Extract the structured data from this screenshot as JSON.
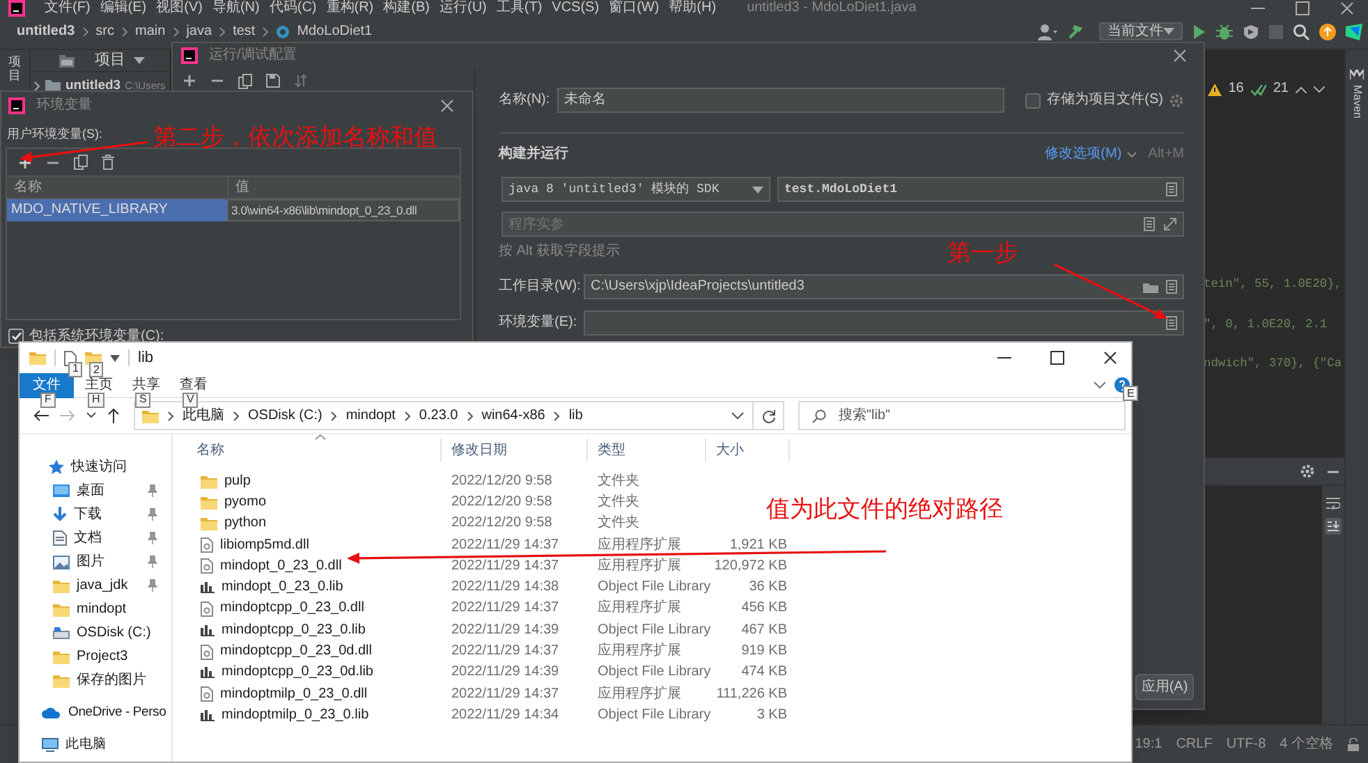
{
  "ide": {
    "title": "untitled3 - MdoLoDiet1.java",
    "menu": [
      "文件(F)",
      "编辑(E)",
      "视图(V)",
      "导航(N)",
      "代码(C)",
      "重构(R)",
      "构建(B)",
      "运行(U)",
      "工具(T)",
      "VCS(S)",
      "窗口(W)",
      "帮助(H)"
    ],
    "breadcrumbs": [
      "untitled3",
      "src",
      "main",
      "java",
      "test",
      "MdoLoDiet1"
    ],
    "run_target": "当前文件",
    "left_tab": "项目",
    "project_tab": "项目",
    "project_root": {
      "name": "untitled3",
      "path": "C:\\Users"
    },
    "inspections": {
      "warnings": "16",
      "checks": "21"
    },
    "code_lines": [
      "tein\", 55, 1.0E20},",
      "\", 0, 1.0E20, 2.1",
      "ndwich\", 370}, {\"Ca"
    ],
    "right_tab": "Maven",
    "status_bar": [
      "19:1",
      "CRLF",
      "UTF-8",
      "4 个空格"
    ]
  },
  "run_dialog": {
    "title": "运行/调试配置",
    "name_label": "名称(N):",
    "name_value": "未命名",
    "store_checkbox": {
      "label": "存储为项目文件(S)",
      "checked": false
    },
    "section": "构建并运行",
    "modify_link": "修改选项(M)",
    "shortcut": "Alt+M",
    "sdk": "java 8 'untitled3' 模块的 SDK",
    "main_class": "test.MdoLoDiet1",
    "args_placeholder": "程序实参",
    "hint": "按 Alt 获取字段提示",
    "workdir_label": "工作目录(W):",
    "workdir_value": "C:\\Users\\xjp\\IdeaProjects\\untitled3",
    "env_label": "环境变量(E):",
    "apply_button": "应用(A)"
  },
  "env_dialog": {
    "title": "环境变量",
    "user_label": "用户环境变量(S):",
    "columns": [
      "名称",
      "值"
    ],
    "rows": [
      {
        "name": "MDO_NATIVE_LIBRARY",
        "value": "3.0\\win64-x86\\lib\\mindopt_0_23_0.dll",
        "selected": true
      }
    ],
    "include_system": {
      "label": "包括系统环境变量(C):",
      "checked": true
    }
  },
  "explorer": {
    "title": "lib",
    "quick_access": [
      {
        "key_tip": "1"
      },
      {
        "key_tip": "2"
      }
    ],
    "ribbon": [
      {
        "label": "文件",
        "key_tip": "F",
        "kind": "file_menu"
      },
      {
        "label": "主页",
        "key_tip": "H",
        "kind": "tab"
      },
      {
        "label": "共享",
        "key_tip": "S",
        "kind": "tab"
      },
      {
        "label": "查看",
        "key_tip": "V",
        "kind": "tab"
      }
    ],
    "help_key_tip": "E",
    "address": [
      "此电脑",
      "OSDisk (C:)",
      "mindopt",
      "0.23.0",
      "win64-x86",
      "lib"
    ],
    "search_placeholder": "搜索\"lib\"",
    "nav": [
      {
        "label": "快速访问",
        "kind": "quick",
        "pinned": false
      },
      {
        "label": "桌面",
        "kind": "desktop",
        "pinned": true
      },
      {
        "label": "下载",
        "kind": "download",
        "pinned": true
      },
      {
        "label": "文档",
        "kind": "documents",
        "pinned": true
      },
      {
        "label": "图片",
        "kind": "pictures",
        "pinned": true
      },
      {
        "label": "java_jdk",
        "kind": "folder",
        "pinned": true
      },
      {
        "label": "mindopt",
        "kind": "folder",
        "pinned": false
      },
      {
        "label": "OSDisk (C:)",
        "kind": "drive",
        "pinned": false
      },
      {
        "label": "Project3",
        "kind": "folder",
        "pinned": false
      },
      {
        "label": "保存的图片",
        "kind": "folder",
        "pinned": false
      },
      {
        "label": "OneDrive - Perso",
        "kind": "onedrive",
        "pinned": false
      },
      {
        "label": "此电脑",
        "kind": "pc",
        "pinned": false
      }
    ],
    "columns": [
      "名称",
      "修改日期",
      "类型",
      "大小"
    ],
    "files": [
      {
        "name": "pulp",
        "date": "2022/12/20 9:58",
        "type": "文件夹",
        "kind": "folder"
      },
      {
        "name": "pyomo",
        "date": "2022/12/20 9:58",
        "type": "文件夹",
        "kind": "folder"
      },
      {
        "name": "python",
        "date": "2022/12/20 9:58",
        "type": "文件夹",
        "kind": "folder"
      },
      {
        "name": "libiomp5md.dll",
        "date": "2022/11/29 14:37",
        "type": "应用程序扩展",
        "size": "1,921 KB",
        "kind": "dll"
      },
      {
        "name": "mindopt_0_23_0.dll",
        "date": "2022/11/29 14:37",
        "type": "应用程序扩展",
        "size": "120,972 KB",
        "kind": "dll"
      },
      {
        "name": "mindopt_0_23_0.lib",
        "date": "2022/11/29 14:38",
        "type": "Object File Library",
        "size": "36 KB",
        "kind": "lib"
      },
      {
        "name": "mindoptcpp_0_23_0.dll",
        "date": "2022/11/29 14:37",
        "type": "应用程序扩展",
        "size": "456 KB",
        "kind": "dll"
      },
      {
        "name": "mindoptcpp_0_23_0.lib",
        "date": "2022/11/29 14:39",
        "type": "Object File Library",
        "size": "467 KB",
        "kind": "lib"
      },
      {
        "name": "mindoptcpp_0_23_0d.dll",
        "date": "2022/11/29 14:37",
        "type": "应用程序扩展",
        "size": "919 KB",
        "kind": "dll"
      },
      {
        "name": "mindoptcpp_0_23_0d.lib",
        "date": "2022/11/29 14:39",
        "type": "Object File Library",
        "size": "474 KB",
        "kind": "lib"
      },
      {
        "name": "mindoptmilp_0_23_0.dll",
        "date": "2022/11/29 14:37",
        "type": "应用程序扩展",
        "size": "111,226 KB",
        "kind": "dll"
      },
      {
        "name": "mindoptmilp_0_23_0.lib",
        "date": "2022/11/29 14:34",
        "type": "Object File Library",
        "size": "3 KB",
        "kind": "lib"
      }
    ]
  },
  "annotations": [
    {
      "text": "第二步，依次添加名称和值"
    },
    {
      "text": "第一步"
    },
    {
      "text": "值为此文件的绝对路径"
    }
  ]
}
